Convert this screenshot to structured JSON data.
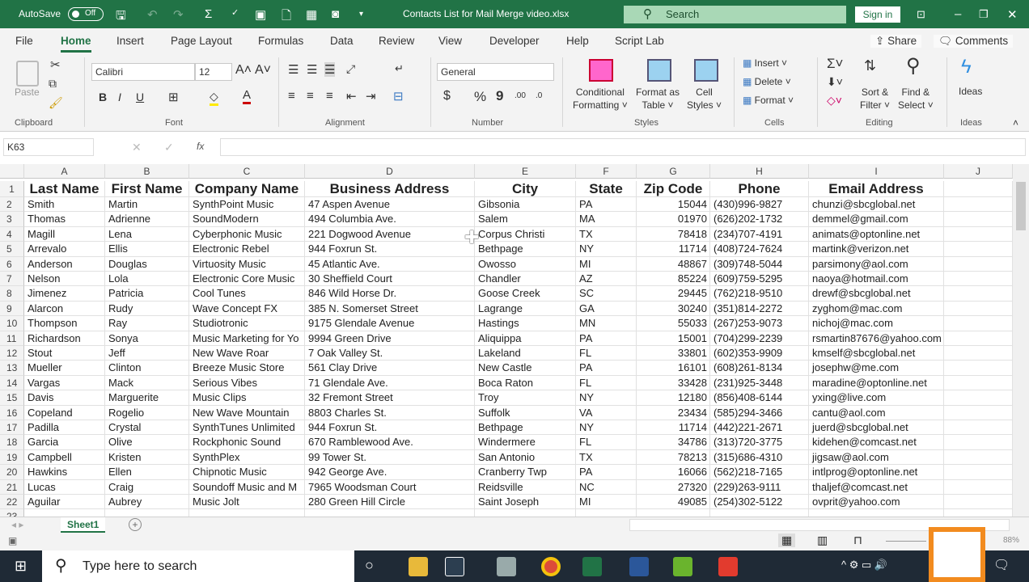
{
  "titlebar": {
    "autosave": "AutoSave",
    "autosave_state": "Off",
    "title": "Contacts List for Mail Merge video.xlsx",
    "search": "Search",
    "sign_in": "Sign in"
  },
  "menu": {
    "tabs": [
      "File",
      "Home",
      "Insert",
      "Page Layout",
      "Formulas",
      "Data",
      "Review",
      "View",
      "Developer",
      "Help",
      "Script Lab"
    ],
    "share": "Share",
    "comments": "Comments"
  },
  "ribbon": {
    "clipboard": {
      "paste": "Paste",
      "label": "Clipboard"
    },
    "font": {
      "name": "Calibri",
      "size": "12",
      "label": "Font",
      "bold": "B",
      "italic": "I",
      "underline": "U"
    },
    "alignment": {
      "label": "Alignment"
    },
    "number": {
      "format": "General",
      "label": "Number",
      "currency": "$",
      "percent": "%",
      "comma": "9"
    },
    "styles": {
      "conditional": "Conditional",
      "conditional2": "Formatting",
      "format_table": "Format as",
      "format_table2": "Table",
      "cell_styles": "Cell",
      "cell_styles2": "Styles",
      "label": "Styles"
    },
    "cells": {
      "insert": "Insert",
      "delete": "Delete",
      "format": "Format",
      "label": "Cells"
    },
    "editing": {
      "sort": "Sort &",
      "sort2": "Filter",
      "find": "Find &",
      "find2": "Select",
      "label": "Editing"
    },
    "ideas": {
      "ideas": "Ideas",
      "label": "Ideas"
    }
  },
  "formula_bar": {
    "name_box": "K63",
    "fx": "fx",
    "value": ""
  },
  "columns": [
    "A",
    "B",
    "C",
    "D",
    "E",
    "F",
    "G",
    "H",
    "I",
    "J"
  ],
  "headers": [
    "Last Name",
    "First Name",
    "Company Name",
    "Business Address",
    "City",
    "State",
    "Zip Code",
    "Phone",
    "Email Address"
  ],
  "rows": [
    [
      "Smith",
      "Martin",
      "SynthPoint Music",
      "47 Aspen Avenue",
      "Gibsonia",
      "PA",
      "15044",
      "(430)996-9827",
      "chunzi@sbcglobal.net"
    ],
    [
      "Thomas",
      "Adrienne",
      "SoundModern",
      "494 Columbia Ave.",
      "Salem",
      "MA",
      "01970",
      "(626)202-1732",
      "demmel@gmail.com"
    ],
    [
      "Magill",
      "Lena",
      "Cyberphonic Music",
      "221 Dogwood Avenue",
      "Corpus Christi",
      "TX",
      "78418",
      "(234)707-4191",
      "animats@optonline.net"
    ],
    [
      "Arrevalo",
      "Ellis",
      "Electronic Rebel",
      "944 Foxrun St.",
      "Bethpage",
      "NY",
      "11714",
      "(408)724-7624",
      "martink@verizon.net"
    ],
    [
      "Anderson",
      "Douglas",
      "Virtuosity Music",
      "45 Atlantic Ave.",
      "Owosso",
      "MI",
      "48867",
      "(309)748-5044",
      "parsimony@aol.com"
    ],
    [
      "Nelson",
      "Lola",
      "Electronic Core Music",
      "30 Sheffield Court",
      "Chandler",
      "AZ",
      "85224",
      "(609)759-5295",
      "naoya@hotmail.com"
    ],
    [
      "Jimenez",
      "Patricia",
      "Cool Tunes",
      "846 Wild Horse Dr.",
      "Goose Creek",
      "SC",
      "29445",
      "(762)218-9510",
      "drewf@sbcglobal.net"
    ],
    [
      "Alarcon",
      "Rudy",
      "Wave Concept FX",
      "385 N. Somerset Street",
      "Lagrange",
      "GA",
      "30240",
      "(351)814-2272",
      "zyghom@mac.com"
    ],
    [
      "Thompson",
      "Ray",
      "Studiotronic",
      "9175 Glendale Avenue",
      "Hastings",
      "MN",
      "55033",
      "(267)253-9073",
      "nichoj@mac.com"
    ],
    [
      "Richardson",
      "Sonya",
      "Music Marketing for Yo",
      "9994 Green Drive",
      "Aliquippa",
      "PA",
      "15001",
      "(704)299-2239",
      "rsmartin87676@yahoo.com"
    ],
    [
      "Stout",
      "Jeff",
      "New Wave Roar",
      "7 Oak Valley St.",
      "Lakeland",
      "FL",
      "33801",
      "(602)353-9909",
      "kmself@sbcglobal.net"
    ],
    [
      "Mueller",
      "Clinton",
      "Breeze Music Store",
      "561 Clay Drive",
      "New Castle",
      "PA",
      "16101",
      "(608)261-8134",
      "josephw@me.com"
    ],
    [
      "Vargas",
      "Mack",
      "Serious Vibes",
      "71 Glendale Ave.",
      "Boca Raton",
      "FL",
      "33428",
      "(231)925-3448",
      "maradine@optonline.net"
    ],
    [
      "Davis",
      "Marguerite",
      "Music Clips",
      "32 Fremont Street",
      "Troy",
      "NY",
      "12180",
      "(856)408-6144",
      "yxing@live.com"
    ],
    [
      "Copeland",
      "Rogelio",
      "New Wave Mountain",
      "8803 Charles St.",
      "Suffolk",
      "VA",
      "23434",
      "(585)294-3466",
      "cantu@aol.com"
    ],
    [
      "Padilla",
      "Crystal",
      "SynthTunes Unlimited",
      "944 Foxrun St.",
      "Bethpage",
      "NY",
      "11714",
      "(442)221-2671",
      "juerd@sbcglobal.net"
    ],
    [
      "Garcia",
      "Olive",
      "Rockphonic Sound",
      "670 Ramblewood Ave.",
      "Windermere",
      "FL",
      "34786",
      "(313)720-3775",
      "kidehen@comcast.net"
    ],
    [
      "Campbell",
      "Kristen",
      "SynthPlex",
      "99 Tower St.",
      "San Antonio",
      "TX",
      "78213",
      "(315)686-4310",
      "jigsaw@aol.com"
    ],
    [
      "Hawkins",
      "Ellen",
      "Chipnotic Music",
      "942 George Ave.",
      "Cranberry Twp",
      "PA",
      "16066",
      "(562)218-7165",
      "intlprog@optonline.net"
    ],
    [
      "Lucas",
      "Craig",
      "Soundoff Music and M",
      "7965 Woodsman Court",
      "Reidsville",
      "NC",
      "27320",
      "(229)263-9111",
      "thaljef@comcast.net"
    ],
    [
      "Aguilar",
      "Aubrey",
      "Music Jolt",
      "280 Green Hill Circle",
      "Saint Joseph",
      "MI",
      "49085",
      "(254)302-5122",
      "ovprit@yahoo.com"
    ]
  ],
  "sheet_tabs": [
    "Sheet1"
  ],
  "status": {
    "zoom": "88%"
  },
  "taskbar": {
    "search_placeholder": "Type here to search"
  }
}
